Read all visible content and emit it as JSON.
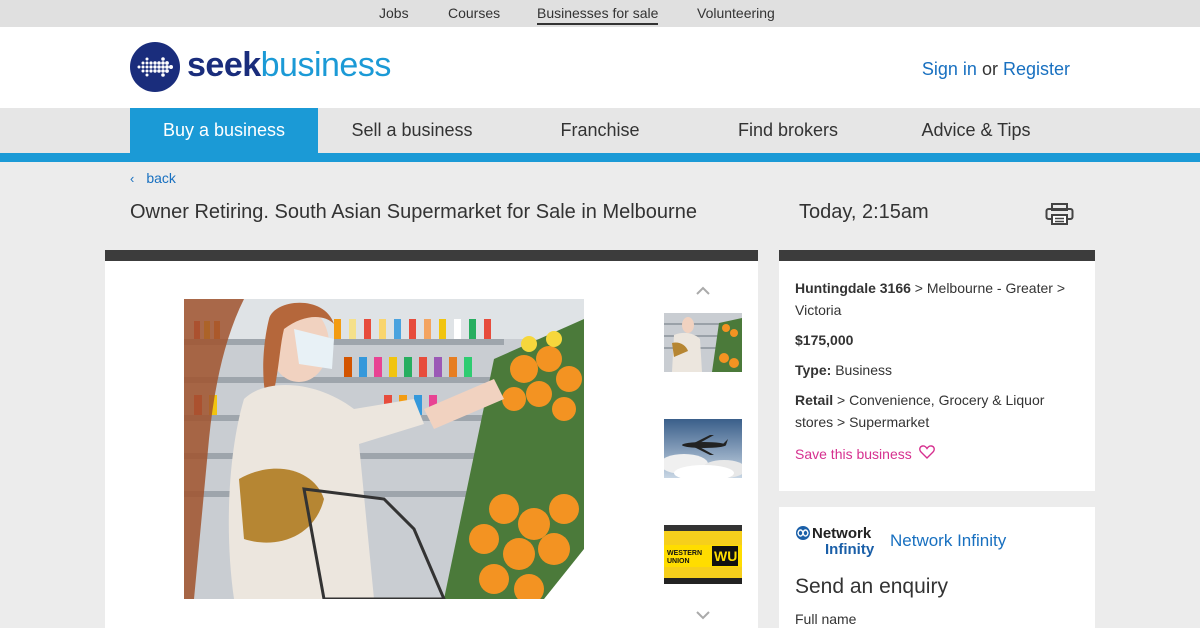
{
  "topbar": {
    "jobs": "Jobs",
    "courses": "Courses",
    "businesses_for_sale": "Businesses for sale",
    "volunteering": "Volunteering"
  },
  "header": {
    "logo_seek": "seek",
    "logo_business": "business",
    "sign_in": "Sign in",
    "or": "or",
    "register": "Register"
  },
  "nav": {
    "items": [
      "Buy a business",
      "Sell a business",
      "Franchise",
      "Find brokers",
      "Advice & Tips"
    ],
    "active": "Buy a business"
  },
  "back_label": "back",
  "listing": {
    "title": "Owner Retiring. South Asian Supermarket for Sale in Melbourne",
    "date": "Today, 2:15am",
    "suburb": "Huntingdale 3166",
    "region": " > Melbourne - Greater > Victoria",
    "price": "$175,000",
    "type_label": "Type:",
    "type_value": " Business",
    "category": "Retail",
    "category_path": " > Convenience, Grocery & Liquor stores > Supermarket",
    "save_label": "Save this business"
  },
  "agency": {
    "logo_line1": "Network",
    "logo_line2": "Infinity",
    "name": "Network Infinity"
  },
  "enquiry": {
    "title": "Send an enquiry",
    "full_name_label": "Full name"
  },
  "thumbs": {
    "western_union_line1": "WESTERN",
    "western_union_line2": "UNION",
    "western_union_mark": "WU"
  },
  "colors": {
    "brand_blue": "#1b9ad6",
    "navy": "#1a2d7c",
    "link": "#1870c0",
    "save_pink": "#d6308f"
  },
  "icons": [
    "logo-icon",
    "chevron-left-icon",
    "printer-icon",
    "chevron-up-icon",
    "chevron-down-icon",
    "heart-icon"
  ]
}
